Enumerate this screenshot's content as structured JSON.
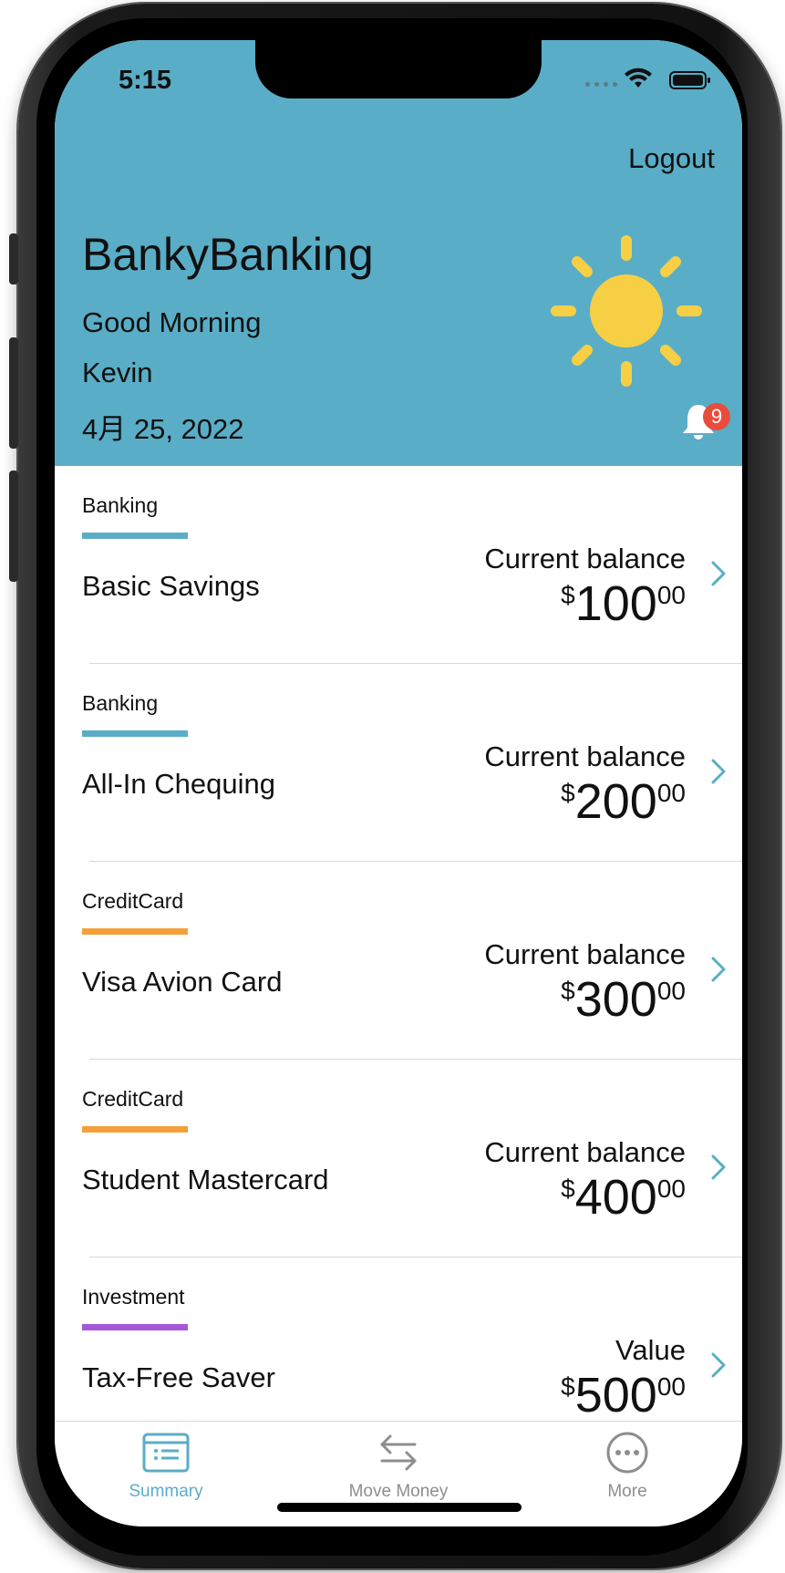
{
  "status_bar": {
    "time": "5:15"
  },
  "header": {
    "logout_label": "Logout",
    "app_title": "BankyBanking",
    "greeting": "Good Morning",
    "user_name": "Kevin",
    "date": "4月 25, 2022",
    "notification_count": "9",
    "weather_icon": "sun-icon"
  },
  "colors": {
    "header_bg": "#5aadc6",
    "banking": "#5aadc6",
    "credit_card": "#f4a03a",
    "investment": "#a557d7",
    "sun": "#f7cf45",
    "badge": "#e84c3d",
    "tab_active": "#5aadc6",
    "tab_inactive": "#8e8e8e"
  },
  "accounts": [
    {
      "type": "Banking",
      "name": "Basic Savings",
      "balance_label": "Current balance",
      "currency": "$",
      "whole": "100",
      "cents": "00"
    },
    {
      "type": "Banking",
      "name": "All-In Chequing",
      "balance_label": "Current balance",
      "currency": "$",
      "whole": "200",
      "cents": "00"
    },
    {
      "type": "CreditCard",
      "name": "Visa Avion Card",
      "balance_label": "Current balance",
      "currency": "$",
      "whole": "300",
      "cents": "00"
    },
    {
      "type": "CreditCard",
      "name": "Student Mastercard",
      "balance_label": "Current balance",
      "currency": "$",
      "whole": "400",
      "cents": "00"
    },
    {
      "type": "Investment",
      "name": "Tax-Free Saver",
      "balance_label": "Value",
      "currency": "$",
      "whole": "500",
      "cents": "00"
    }
  ],
  "tabs": [
    {
      "label": "Summary",
      "icon": "list-icon",
      "active": true
    },
    {
      "label": "Move Money",
      "icon": "transfer-arrows-icon",
      "active": false
    },
    {
      "label": "More",
      "icon": "more-dots-icon",
      "active": false
    }
  ]
}
